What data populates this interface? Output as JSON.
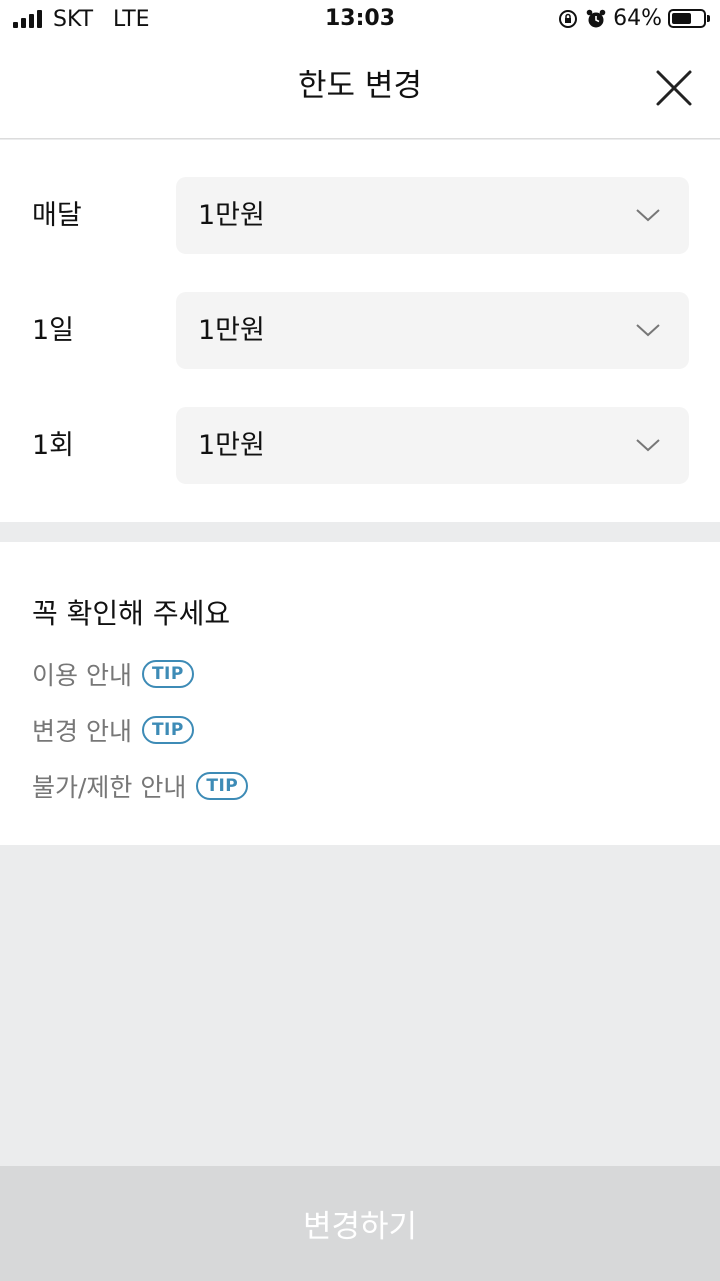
{
  "status_bar": {
    "carrier": "SKT",
    "network": "LTE",
    "time": "13:03",
    "battery_percent": "64%",
    "battery_level": 0.64,
    "icons": [
      "signal-icon",
      "rotation-lock-icon",
      "alarm-icon",
      "battery-icon"
    ]
  },
  "header": {
    "title": "한도 변경",
    "close_icon": "close-icon"
  },
  "limits": {
    "rows": [
      {
        "label": "매달",
        "value": "1만원",
        "icon": "chevron-down-icon"
      },
      {
        "label": "1일",
        "value": "1만원",
        "icon": "chevron-down-icon"
      },
      {
        "label": "1회",
        "value": "1만원",
        "icon": "chevron-down-icon"
      }
    ]
  },
  "notice": {
    "title": "꼭 확인해 주세요",
    "items": [
      {
        "label": "이용 안내",
        "badge": "TIP"
      },
      {
        "label": "변경 안내",
        "badge": "TIP"
      },
      {
        "label": "불가/제한 안내",
        "badge": "TIP"
      }
    ]
  },
  "footer": {
    "submit_label": "변경하기"
  },
  "colors": {
    "accent_tip": "#3d8bb6",
    "background": "#ebeced",
    "select_background": "#f4f4f4",
    "disabled_button": "#d7d8d9"
  }
}
